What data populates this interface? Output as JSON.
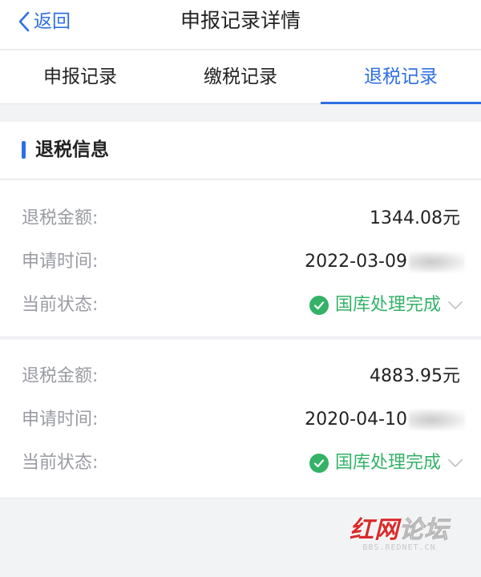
{
  "navbar": {
    "back_label": "返回",
    "title": "申报记录详情"
  },
  "tabs": [
    {
      "label": "申报记录",
      "active": false
    },
    {
      "label": "缴税记录",
      "active": false
    },
    {
      "label": "退税记录",
      "active": true
    }
  ],
  "section": {
    "title": "退税信息"
  },
  "records": [
    {
      "amount_label": "退税金额:",
      "amount": "1344.08元",
      "date_label": "申请时间:",
      "date": "2022-03-09",
      "status_label": "当前状态:",
      "status": "国库处理完成"
    },
    {
      "amount_label": "退税金额:",
      "amount": "4883.95元",
      "date_label": "申请时间:",
      "date": "2020-04-10",
      "status_label": "当前状态:",
      "status": "国库处理完成"
    }
  ],
  "watermark": {
    "logo": "红网论坛",
    "logo_red": "红网",
    "logo_white": "论坛",
    "url": "BBS.REDNET.CN"
  },
  "colors": {
    "accent": "#2f6fe4",
    "success": "#34b268",
    "label": "#9a9ca3",
    "background": "#f2f3f5"
  },
  "icons": {
    "back": "chevron-left-icon",
    "status": "check-circle-icon",
    "expand": "chevron-down-icon"
  }
}
